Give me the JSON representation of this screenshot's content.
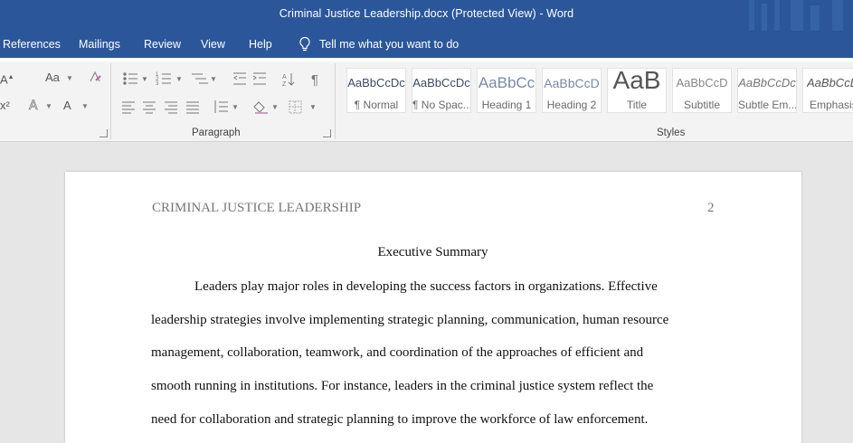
{
  "window": {
    "title": "Criminal Justice Leadership.docx (Protected View)  -  Word"
  },
  "menu": {
    "items": [
      "References",
      "Mailings",
      "Review",
      "View",
      "Help"
    ],
    "tell_me": "Tell me what you want to do"
  },
  "ribbon": {
    "groups": {
      "paragraph": "Paragraph",
      "styles": "Styles"
    },
    "font_buttons": [
      "A",
      "Aa",
      "A",
      "x²",
      "A",
      "A"
    ],
    "styles": [
      {
        "sample": "AaBbCcDc",
        "name": "¶ Normal"
      },
      {
        "sample": "AaBbCcDc",
        "name": "¶ No Spac..."
      },
      {
        "sample": "AaBbCc",
        "name": "Heading 1"
      },
      {
        "sample": "AaBbCcD",
        "name": "Heading 2"
      },
      {
        "sample": "AaB",
        "name": "Title"
      },
      {
        "sample": "AaBbCcD",
        "name": "Subtitle"
      },
      {
        "sample": "AaBbCcDc",
        "name": "Subtle Em..."
      },
      {
        "sample": "AaBbCcDc",
        "name": "Emphasis"
      }
    ]
  },
  "document": {
    "header_left": "CRIMINAL JUSTICE LEADERSHIP",
    "page_number": "2",
    "heading": "Executive Summary",
    "lines": [
      "Leaders play major roles in developing the success factors in organizations. Effective",
      "leadership strategies involve implementing strategic planning, communication, human resource",
      "management, collaboration, teamwork, and coordination of the approaches of efficient and",
      "smooth running in institutions. For instance, leaders in the criminal justice system reflect the",
      "need for collaboration and strategic planning to improve the workforce of law enforcement."
    ]
  },
  "colors": {
    "title_bar": "#2b579a",
    "ribbon": "#f3f3f3",
    "canvas": "#e6e6e6"
  }
}
